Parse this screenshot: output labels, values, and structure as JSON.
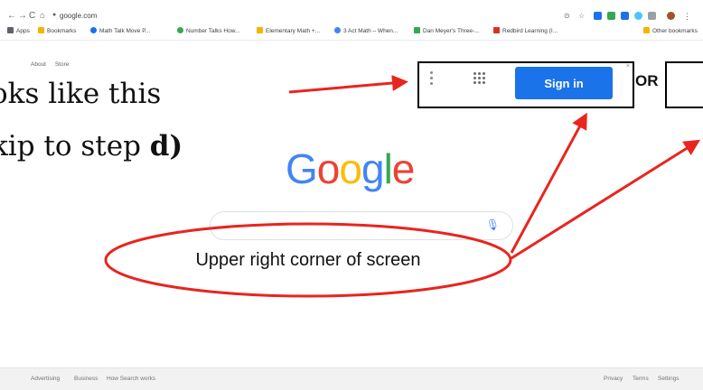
{
  "browser": {
    "nav": [
      "←",
      "→",
      "C",
      "⌂"
    ],
    "url": "google.com",
    "bookmarks": [
      {
        "label": "Apps",
        "color": "#5f6368"
      },
      {
        "label": "Bookmarks",
        "color": "#f4b400"
      },
      {
        "label": "Math Talk Move P...",
        "color": "#1a73e8"
      },
      {
        "label": "Number Talks How...",
        "color": "#34a853"
      },
      {
        "label": "Elementary Math +...",
        "color": "#f4b400"
      },
      {
        "label": "3 Act Math – When...",
        "color": "#4285f4"
      },
      {
        "label": "Dan Meyer's Three-...",
        "color": "#34a853"
      },
      {
        "label": "Redbird Learning (I...",
        "color": "#d93025"
      }
    ],
    "other_bookmarks": "Other bookmarks"
  },
  "google": {
    "top_links": [
      "About",
      "Store"
    ],
    "logo_letters": [
      {
        "ch": "G",
        "color": "#4285f4"
      },
      {
        "ch": "o",
        "color": "#ea4335"
      },
      {
        "ch": "o",
        "color": "#fbbc05"
      },
      {
        "ch": "g",
        "color": "#4285f4"
      },
      {
        "ch": "l",
        "color": "#34a853"
      },
      {
        "ch": "e",
        "color": "#ea4335"
      }
    ],
    "footer_left": [
      "Advertising",
      "Business",
      "How Search works"
    ],
    "footer_right": [
      "Privacy",
      "Terms",
      "Settings"
    ]
  },
  "annotation": {
    "line1": "oks like this",
    "line2_prefix": "kip to step ",
    "line2_bold": "d)",
    "sign_in": "Sign in",
    "or_label": "OR",
    "note": "Upper right corner of screen"
  },
  "colors": {
    "arrow": "#e8251f",
    "signin_bg": "#1a73e8"
  }
}
